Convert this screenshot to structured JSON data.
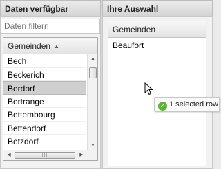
{
  "left_panel": {
    "title": "Daten verfügbar",
    "filter_placeholder": "Daten filtern",
    "column": "Gemeinden",
    "sort_glyph": "▲",
    "rows": [
      "Bech",
      "Beckerich",
      "Berdorf",
      "Bertrange",
      "Bettembourg",
      "Bettendorf",
      "Betzdorf"
    ],
    "selected_row": "Berdorf",
    "hscroll_grip": "|||"
  },
  "right_panel": {
    "title": "Ihre Auswahl",
    "column": "Gemeinden",
    "rows": [
      "Beaufort"
    ]
  },
  "tooltip": {
    "text": "1 selected row",
    "icon": "check-circle-icon",
    "icon_glyph": "✓"
  },
  "colors": {
    "selection": "#cfcfcf",
    "ok_green": "#5cb531"
  }
}
